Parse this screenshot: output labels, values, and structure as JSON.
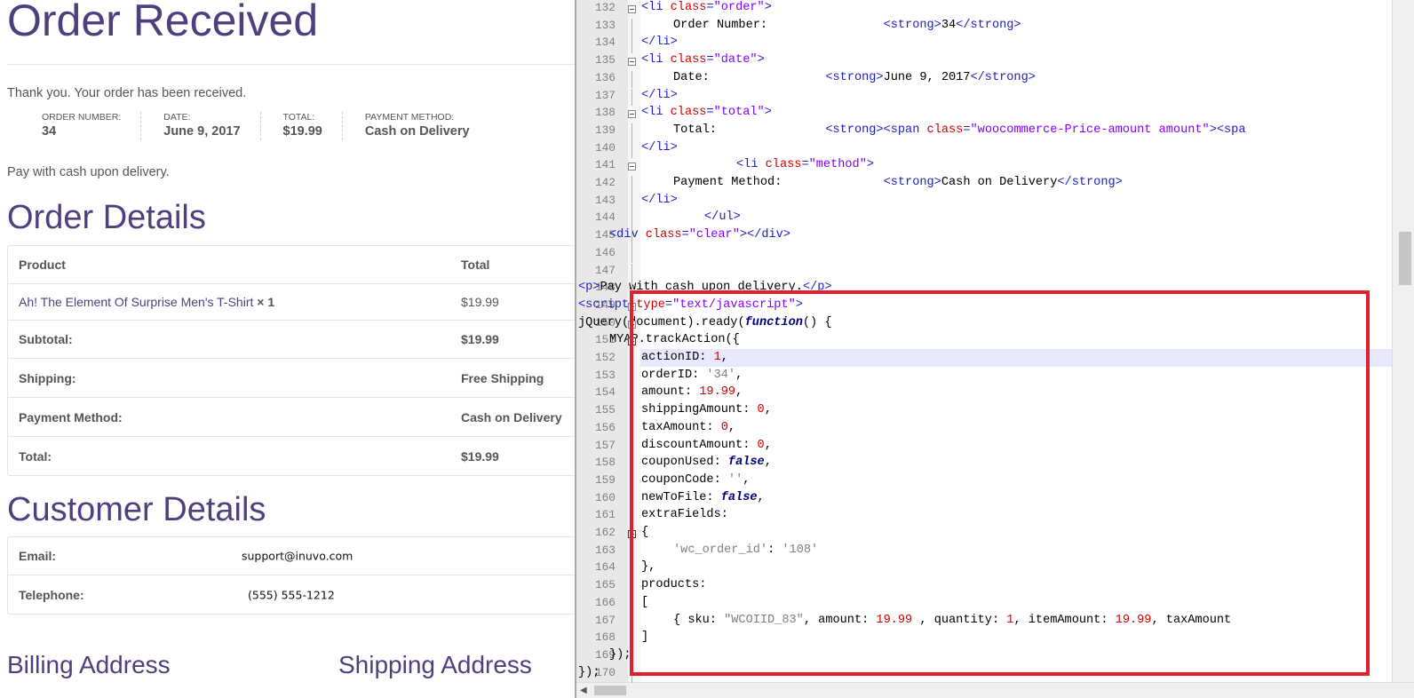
{
  "webpage": {
    "order_title": "Order Received",
    "thanks": "Thank you. Your order has been received.",
    "overview": [
      {
        "label": "ORDER NUMBER:",
        "value": "34"
      },
      {
        "label": "DATE:",
        "value": "June 9, 2017"
      },
      {
        "label": "TOTAL:",
        "value": "$19.99"
      },
      {
        "label": "PAYMENT METHOD:",
        "value": "Cash on Delivery"
      }
    ],
    "pay_note": "Pay with cash upon delivery.",
    "details_title": "Order Details",
    "order_table": {
      "header": {
        "product": "Product",
        "total": "Total"
      },
      "item": {
        "name": "Ah! The Element Of Surprise Men's T-Shirt",
        "qty": "× 1",
        "price": "$19.99"
      },
      "subtotal": {
        "label": "Subtotal:",
        "value": "$19.99"
      },
      "shipping": {
        "label": "Shipping:",
        "value": "Free Shipping"
      },
      "payment": {
        "label": "Payment Method:",
        "value": "Cash on Delivery"
      },
      "total": {
        "label": "Total:",
        "value": "$19.99"
      }
    },
    "customer_title": "Customer Details",
    "customer": {
      "email_label": "Email:",
      "email": "support@inuvo.com",
      "phone_label": "Telephone:",
      "phone": "(555) 555-1212"
    },
    "billing_title": "Billing Address",
    "shipping_title": "Shipping Address"
  },
  "editor": {
    "lines": [
      {
        "n": "132",
        "html": "<span class='tag'>&lt;li </span><span class='attr'>class</span><span class='tag'>=</span><span class='str'>\"order\"</span><span class='tag'>&gt;</span>",
        "indent": 720
      },
      {
        "n": "133",
        "html": "Order Number:                <span class='tag'>&lt;strong&gt;</span>34<span class='tag'>&lt;/strong&gt;</span>",
        "indent": 756
      },
      {
        "n": "134",
        "html": "<span class='tag'>&lt;/li&gt;</span>",
        "indent": 720
      },
      {
        "n": "135",
        "html": "<span class='tag'>&lt;li </span><span class='attr'>class</span><span class='tag'>=</span><span class='str'>\"date\"</span><span class='tag'>&gt;</span>",
        "indent": 720
      },
      {
        "n": "136",
        "html": "Date:                <span class='tag'>&lt;strong&gt;</span>June 9, 2017<span class='tag'>&lt;/strong&gt;</span>",
        "indent": 756
      },
      {
        "n": "137",
        "html": "<span class='tag'>&lt;/li&gt;</span>",
        "indent": 720
      },
      {
        "n": "138",
        "html": "<span class='tag'>&lt;li </span><span class='attr'>class</span><span class='tag'>=</span><span class='str'>\"total\"</span><span class='tag'>&gt;</span>",
        "indent": 720
      },
      {
        "n": "139",
        "html": "Total:               <span class='tag'>&lt;strong&gt;&lt;span </span><span class='attr'>class</span><span class='tag'>=</span><span class='str'>\"woocommerce-Price-amount amount\"</span><span class='tag'>&gt;&lt;spa</span>",
        "indent": 756
      },
      {
        "n": "140",
        "html": "<span class='tag'>&lt;/li&gt;</span>",
        "indent": 720
      },
      {
        "n": "141",
        "html": "<span class='tag'>&lt;li </span><span class='attr'>class</span><span class='tag'>=</span><span class='str'>\"method\"</span><span class='tag'>&gt;</span>",
        "indent": 827
      },
      {
        "n": "142",
        "html": "Payment Method:              <span class='tag'>&lt;strong&gt;</span>Cash on Delivery<span class='tag'>&lt;/strong&gt;</span>",
        "indent": 756
      },
      {
        "n": "143",
        "html": "<span class='tag'>&lt;/li&gt;</span>",
        "indent": 720
      },
      {
        "n": "144",
        "html": "<span class='tag'>&lt;/ul&gt;</span>",
        "indent": 791
      },
      {
        "n": "145",
        "html": "<span class='tag'>&lt;div </span><span class='attr'>class</span><span class='tag'>=</span><span class='str'>\"clear\"</span><span class='tag'>&gt;&lt;/div&gt;</span>",
        "indent": 684
      },
      {
        "n": "146",
        "html": "",
        "indent": 684
      },
      {
        "n": "147",
        "html": "",
        "indent": 684
      },
      {
        "n": "148",
        "html": "<span class='tag'>&lt;p&gt;</span>Pay with cash upon delivery.<span class='tag'>&lt;/p&gt;</span>",
        "indent": 649
      },
      {
        "n": "149",
        "html": "<span class='tag'>&lt;script </span><span class='attr'>type</span><span class='tag'>=</span><span class='str'>\"text/javascript\"</span><span class='tag'>&gt;</span>",
        "indent": 649
      },
      {
        "n": "150",
        "html": "jQuery(document).ready(<span class='kw'>function</span>() {",
        "indent": 649
      },
      {
        "n": "151",
        "html": "MYAP.trackAction({",
        "indent": 684
      },
      {
        "n": "152",
        "html": "actionID: <span class='num'>1</span>,",
        "indent": 720
      },
      {
        "n": "153",
        "html": "orderID: <span class='jsstr'>'34'</span>,",
        "indent": 720
      },
      {
        "n": "154",
        "html": "amount: <span class='num'>19.99</span>,",
        "indent": 720
      },
      {
        "n": "155",
        "html": "shippingAmount: <span class='num'>0</span>,",
        "indent": 720
      },
      {
        "n": "156",
        "html": "taxAmount: <span class='num'>0</span>,",
        "indent": 720
      },
      {
        "n": "157",
        "html": "discountAmount: <span class='num'>0</span>,",
        "indent": 720
      },
      {
        "n": "158",
        "html": "couponUsed: <span class='kw'>false</span>,",
        "indent": 720
      },
      {
        "n": "159",
        "html": "couponCode: <span class='jsstr'>''</span>,",
        "indent": 720
      },
      {
        "n": "160",
        "html": "newToFile: <span class='kw'>false</span>,",
        "indent": 720
      },
      {
        "n": "161",
        "html": "extraFields:",
        "indent": 720
      },
      {
        "n": "162",
        "html": "{",
        "indent": 720
      },
      {
        "n": "163",
        "html": "<span class='jsstr'>'wc_order_id'</span>: <span class='jsstr'>'108'</span>",
        "indent": 756
      },
      {
        "n": "164",
        "html": "},",
        "indent": 720
      },
      {
        "n": "165",
        "html": "products:",
        "indent": 720
      },
      {
        "n": "166",
        "html": "[",
        "indent": 720
      },
      {
        "n": "167",
        "html": "{ sku: <span class='jsstr'>\"WCOIID_83\"</span>, amount: <span class='num'>19.99</span> , quantity: <span class='num'>1</span>, itemAmount: <span class='num'>19.99</span>, taxAmount",
        "indent": 756
      },
      {
        "n": "168",
        "html": "]",
        "indent": 720
      },
      {
        "n": "169",
        "html": "});",
        "indent": 684
      },
      {
        "n": "170",
        "html": "});",
        "indent": 649
      }
    ],
    "fold_lines": [
      "132",
      "135",
      "138",
      "141",
      "149",
      "150",
      "151",
      "162"
    ],
    "red_fold_lines": [
      "151",
      "162"
    ],
    "current_line": "152",
    "highlight_color": "#e0202a"
  }
}
